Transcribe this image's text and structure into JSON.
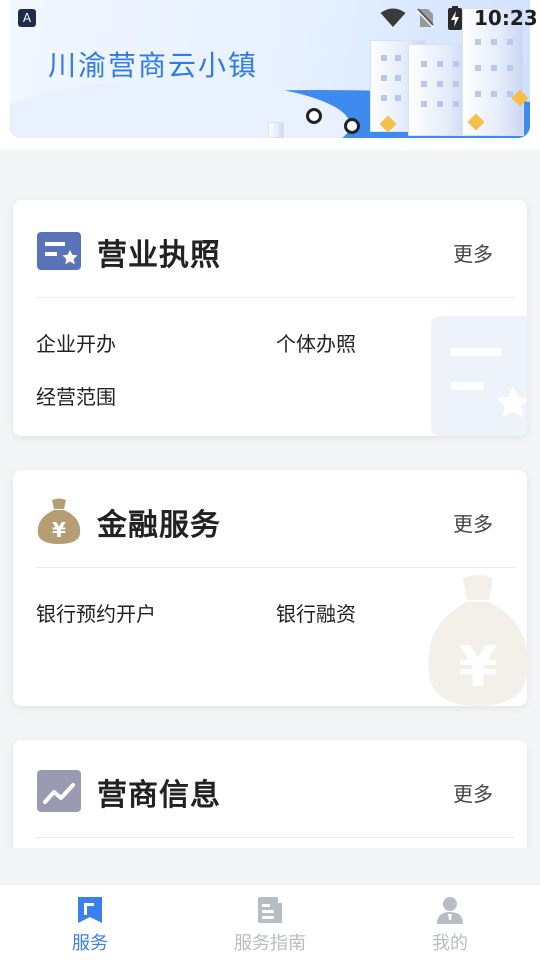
{
  "status_bar": {
    "time": "10:23",
    "app_badge": "A"
  },
  "banner": {
    "title": "川渝营商云小镇"
  },
  "cards": [
    {
      "title": "营业执照",
      "more": "更多",
      "icon": "license-icon",
      "items": [
        "企业开办",
        "个体办照",
        "经营范围"
      ]
    },
    {
      "title": "金融服务",
      "more": "更多",
      "icon": "money-bag-icon",
      "items": [
        "银行预约开户",
        "银行融资"
      ]
    },
    {
      "title": "营商信息",
      "more": "更多",
      "icon": "trend-chart-icon",
      "items": []
    }
  ],
  "tabbar": {
    "tabs": [
      {
        "label": "服务",
        "icon": "bookmark-icon",
        "active": true
      },
      {
        "label": "服务指南",
        "icon": "document-icon",
        "active": false
      },
      {
        "label": "我的",
        "icon": "user-icon",
        "active": false
      }
    ],
    "active_color": "#3a7ff0",
    "inactive_color": "#b8bcc4"
  }
}
